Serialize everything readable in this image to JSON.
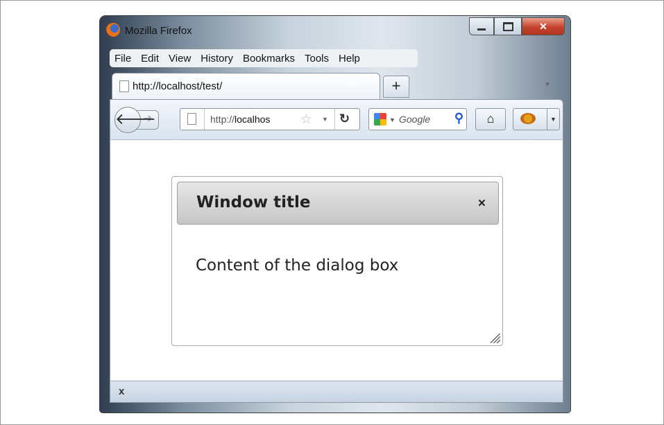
{
  "window": {
    "title": "Mozilla Firefox"
  },
  "menubar": {
    "items": [
      "File",
      "Edit",
      "View",
      "History",
      "Bookmarks",
      "Tools",
      "Help"
    ]
  },
  "tab": {
    "title": "http://localhost/test/",
    "new_tab_label": "+"
  },
  "navbar": {
    "url_prefix": "http://",
    "url_host": "localhos",
    "search_placeholder": "Google"
  },
  "dialog": {
    "title": "Window title",
    "close_label": "×",
    "content": "Content of the dialog box"
  },
  "statusbar": {
    "close_label": "x"
  }
}
